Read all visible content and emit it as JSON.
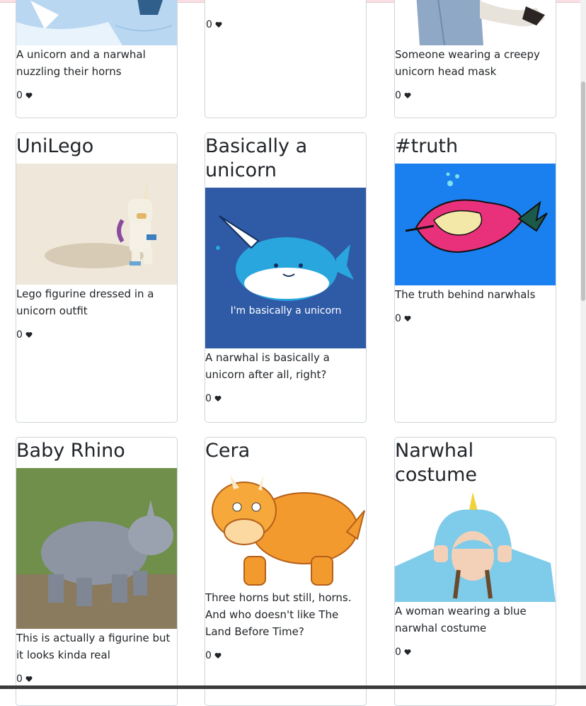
{
  "cards": [
    {
      "id": "c0",
      "title": "",
      "description": "A unicorn and a narwhal nuzzling their horns",
      "likes": "0"
    },
    {
      "id": "c1",
      "title": "",
      "description": "",
      "likes": "0"
    },
    {
      "id": "c2",
      "title": "",
      "description": "Someone wearing a creepy unicorn head mask",
      "likes": "0"
    },
    {
      "id": "c3",
      "title": "UniLego",
      "description": "Lego figurine dressed in a unicorn outfit",
      "likes": "0"
    },
    {
      "id": "c4",
      "title": "Basically a unicorn",
      "description": "A narwhal is basically a unicorn after all, right?",
      "likes": "0",
      "image_caption": "I'm basically a unicorn"
    },
    {
      "id": "c5",
      "title": "#truth",
      "description": "The truth behind narwhals",
      "likes": "0"
    },
    {
      "id": "c6",
      "title": "Baby Rhino",
      "description": "This is actually a figurine but it looks kinda real",
      "likes": "0"
    },
    {
      "id": "c7",
      "title": "Cera",
      "description": "Three horns but still, horns. And who doesn't like The Land Before Time?",
      "likes": "0"
    },
    {
      "id": "c8",
      "title": "Narwhal costume",
      "description": "A woman wearing a blue narwhal costume",
      "likes": "0"
    }
  ],
  "icons": {
    "like": "heart-icon"
  },
  "colors": {
    "heart": "#212529",
    "border": "#cfd4da"
  }
}
